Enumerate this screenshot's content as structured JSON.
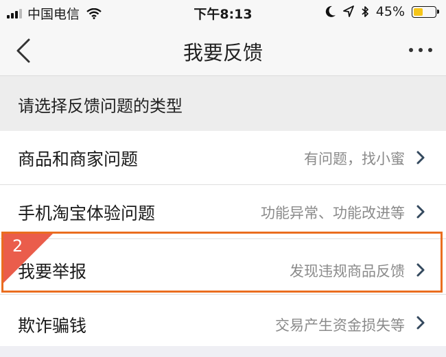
{
  "status_bar": {
    "carrier": "中国电信",
    "time": "下午8:13",
    "battery_percent": "45%",
    "battery_level": 0.45,
    "icons": [
      "signal-icon",
      "wifi-icon",
      "moon-icon",
      "location-arrow-icon",
      "bluetooth-icon",
      "battery-icon"
    ],
    "battery_color": "#f5c518"
  },
  "nav": {
    "title": "我要反馈",
    "back_icon": "chevron-left-icon",
    "more_icon": "more-dots-icon"
  },
  "section": {
    "header": "请选择反馈问题的类型"
  },
  "items": [
    {
      "label": "商品和商家问题",
      "hint": "有问题，找小蜜"
    },
    {
      "label": "手机淘宝体验问题",
      "hint": "功能异常、功能改进等"
    },
    {
      "label": "我要举报",
      "hint": "发现违规商品反馈"
    },
    {
      "label": "欺诈骗钱",
      "hint": "交易产生资金损失等"
    }
  ],
  "annotation": {
    "marker_number": "2",
    "highlight_color": "#ea6d1f",
    "marker_color": "#ea5d4b"
  }
}
